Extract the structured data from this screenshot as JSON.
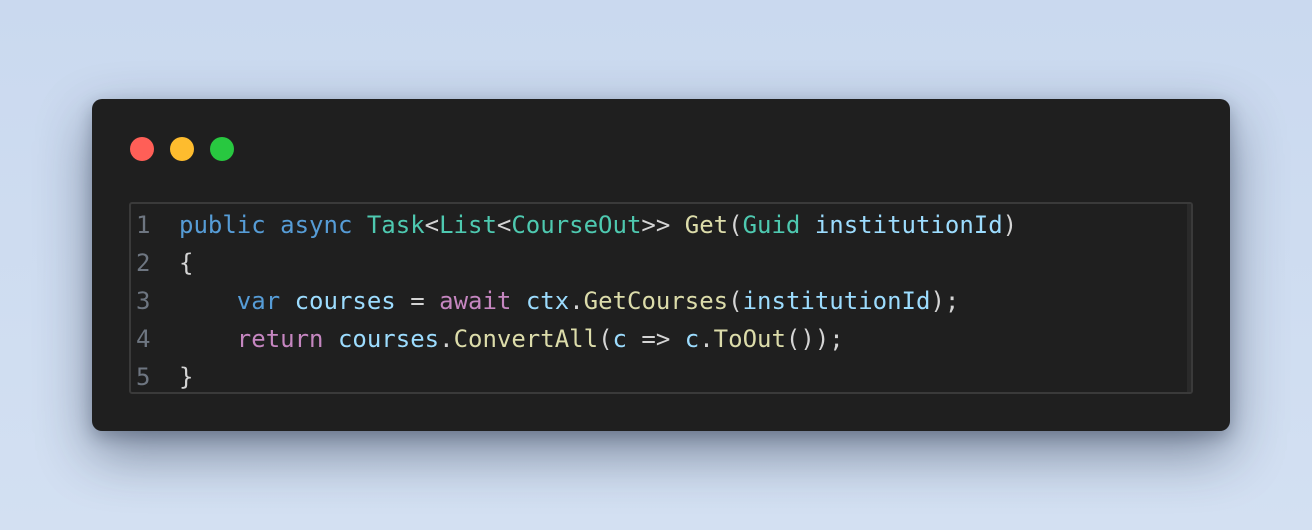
{
  "window": {
    "controls": [
      {
        "name": "close",
        "color": "#ff5f57"
      },
      {
        "name": "minimize",
        "color": "#febc2e"
      },
      {
        "name": "maximize",
        "color": "#28c840"
      }
    ]
  },
  "editor": {
    "language": "C#",
    "lines": [
      {
        "number": "1",
        "tokens": [
          {
            "text": "public",
            "kind": "kw"
          },
          {
            "text": " ",
            "kind": "pu"
          },
          {
            "text": "async",
            "kind": "kw"
          },
          {
            "text": " ",
            "kind": "pu"
          },
          {
            "text": "Task",
            "kind": "ty"
          },
          {
            "text": "<",
            "kind": "pu"
          },
          {
            "text": "List",
            "kind": "ty"
          },
          {
            "text": "<",
            "kind": "pu"
          },
          {
            "text": "CourseOut",
            "kind": "ty"
          },
          {
            "text": ">> ",
            "kind": "pu"
          },
          {
            "text": "Get",
            "kind": "fn"
          },
          {
            "text": "(",
            "kind": "pu"
          },
          {
            "text": "Guid",
            "kind": "ty"
          },
          {
            "text": " ",
            "kind": "pu"
          },
          {
            "text": "institutionId",
            "kind": "pa"
          },
          {
            "text": ")",
            "kind": "pu"
          }
        ]
      },
      {
        "number": "2",
        "tokens": [
          {
            "text": "{",
            "kind": "pu"
          }
        ]
      },
      {
        "number": "3",
        "tokens": [
          {
            "text": "    ",
            "kind": "pu"
          },
          {
            "text": "var",
            "kind": "kw"
          },
          {
            "text": " ",
            "kind": "pu"
          },
          {
            "text": "courses",
            "kind": "pa"
          },
          {
            "text": " = ",
            "kind": "pu"
          },
          {
            "text": "await",
            "kind": "ctrl"
          },
          {
            "text": " ",
            "kind": "pu"
          },
          {
            "text": "ctx",
            "kind": "pa"
          },
          {
            "text": ".",
            "kind": "pu"
          },
          {
            "text": "GetCourses",
            "kind": "fn"
          },
          {
            "text": "(",
            "kind": "pu"
          },
          {
            "text": "institutionId",
            "kind": "pa"
          },
          {
            "text": ");",
            "kind": "pu"
          }
        ]
      },
      {
        "number": "4",
        "tokens": [
          {
            "text": "    ",
            "kind": "pu"
          },
          {
            "text": "return",
            "kind": "ctrl"
          },
          {
            "text": " ",
            "kind": "pu"
          },
          {
            "text": "courses",
            "kind": "pa"
          },
          {
            "text": ".",
            "kind": "pu"
          },
          {
            "text": "ConvertAll",
            "kind": "fn"
          },
          {
            "text": "(",
            "kind": "pu"
          },
          {
            "text": "c",
            "kind": "pa"
          },
          {
            "text": " => ",
            "kind": "pu"
          },
          {
            "text": "c",
            "kind": "pa"
          },
          {
            "text": ".",
            "kind": "pu"
          },
          {
            "text": "ToOut",
            "kind": "fn"
          },
          {
            "text": "());",
            "kind": "pu"
          }
        ]
      },
      {
        "number": "5",
        "tokens": [
          {
            "text": "}",
            "kind": "pu"
          }
        ]
      }
    ]
  }
}
